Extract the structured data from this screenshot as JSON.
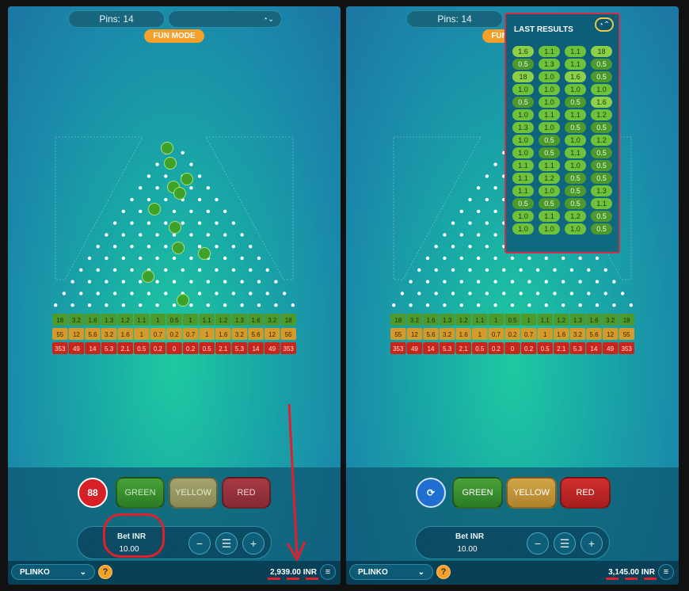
{
  "colors": {
    "accent_orange": "#f5a02a",
    "green_row": "#4e9a2b",
    "yellow_row": "#d49a2a",
    "red_row": "#c8261c",
    "annotation_red": "#e0212c"
  },
  "left": {
    "pins_label": "Pins: 14",
    "fun_mode": "FUN MODE",
    "rows": {
      "green": [
        "18",
        "3.2",
        "1.6",
        "1.3",
        "1.2",
        "1.1",
        "1",
        "0.5",
        "1",
        "1.1",
        "1.2",
        "1.3",
        "1.6",
        "3.2",
        "18"
      ],
      "yellow": [
        "55",
        "12",
        "5.6",
        "3.2",
        "1.6",
        "1",
        "0.7",
        "0.2",
        "0.7",
        "1",
        "1.6",
        "3.2",
        "5.6",
        "12",
        "55"
      ],
      "red": [
        "353",
        "49",
        "14",
        "5.3",
        "2.1",
        "0.5",
        "0.2",
        "0",
        "0.2",
        "0.5",
        "2.1",
        "5.3",
        "14",
        "49",
        "353"
      ]
    },
    "count_badge": "88",
    "btn_green": "GREEN",
    "btn_yellow": "YELLOW",
    "btn_red": "RED",
    "bet_label": "Bet INR",
    "bet_value": "10.00",
    "minus": "−",
    "plus": "+",
    "game_select": "PLINKO",
    "help": "?",
    "balance": "2,939.00 INR"
  },
  "right": {
    "pins_label": "Pins: 14",
    "fun_mode": "FUN MODE",
    "rows": {
      "green": [
        "18",
        "3.2",
        "1.6",
        "1.3",
        "1.2",
        "1.1",
        "1",
        "0.5",
        "1",
        "1.1",
        "1.2",
        "1.3",
        "1.6",
        "3.2",
        "18"
      ],
      "yellow": [
        "55",
        "12",
        "5.6",
        "3.2",
        "1.6",
        "1",
        "0.7",
        "0.2",
        "0.7",
        "1",
        "1.6",
        "3.2",
        "5.6",
        "12",
        "55"
      ],
      "red": [
        "353",
        "49",
        "14",
        "5.3",
        "2.1",
        "0.5",
        "0.2",
        "0",
        "0.2",
        "0.5",
        "2.1",
        "5.3",
        "14",
        "49",
        "353"
      ]
    },
    "btn_green": "GREEN",
    "btn_yellow": "YELLOW",
    "btn_red": "RED",
    "bet_label": "Bet INR",
    "bet_value": "10.00",
    "minus": "−",
    "plus": "+",
    "game_select": "PLINKO",
    "help": "?",
    "balance": "3,145.00 INR",
    "last_results_title": "LAST RESULTS",
    "last_results": [
      [
        "1.6",
        "1.1",
        "1.1",
        "18"
      ],
      [
        "0.5",
        "1.3",
        "1.1",
        "0.5"
      ],
      [
        "18",
        "1.0",
        "1.6",
        "0.5"
      ],
      [
        "1.0",
        "1.0",
        "1.0",
        "1.0"
      ],
      [
        "0.5",
        "1.0",
        "0.5",
        "1.6"
      ],
      [
        "1.0",
        "1.1",
        "1.1",
        "1.2"
      ],
      [
        "1.3",
        "1.0",
        "0.5",
        "0.5"
      ],
      [
        "1.0",
        "0.5",
        "1.0",
        "1.2"
      ],
      [
        "1.0",
        "0.5",
        "1.1",
        "0.5"
      ],
      [
        "1.1",
        "1.1",
        "1.0",
        "0.5"
      ],
      [
        "1.1",
        "1.2",
        "0.5",
        "0.5"
      ],
      [
        "1.1",
        "1.0",
        "0.5",
        "1.3"
      ],
      [
        "0.5",
        "0.5",
        "0.5",
        "1.1"
      ],
      [
        "1.0",
        "1.1",
        "1.2",
        "0.5"
      ],
      [
        "1.0",
        "1.0",
        "1.0",
        "0.5"
      ]
    ]
  }
}
